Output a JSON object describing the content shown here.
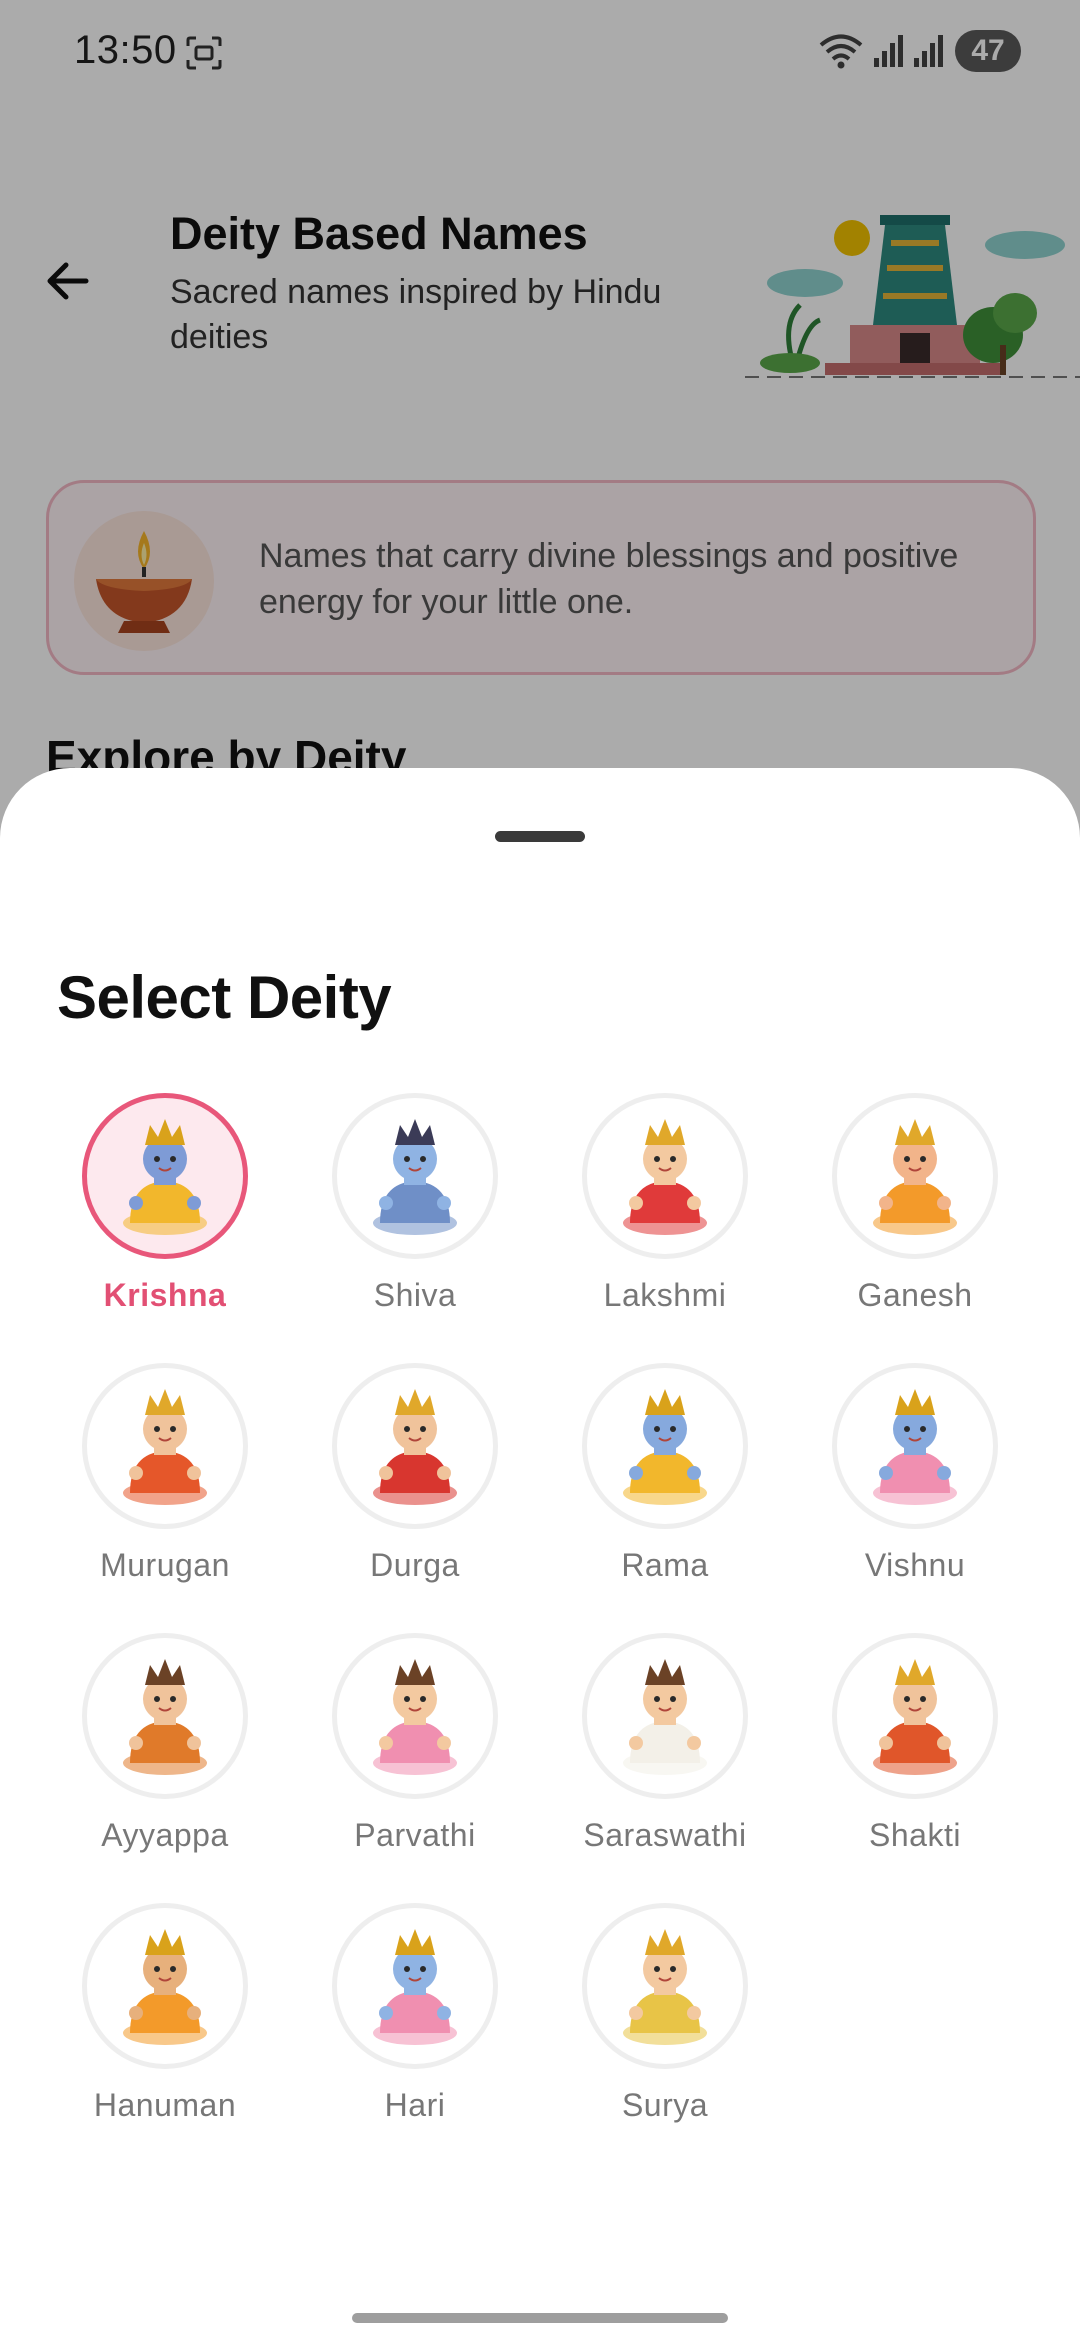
{
  "status_bar": {
    "time": "13:50",
    "battery": "47"
  },
  "header": {
    "title": "Deity Based Names",
    "subtitle": "Sacred names inspired by Hindu deities"
  },
  "info_card": {
    "text": "Names that carry divine blessings and positive energy for your little one."
  },
  "section": {
    "title": "Explore by Deity"
  },
  "sheet": {
    "title": "Select Deity",
    "selected": "Krishna",
    "deities": [
      {
        "label": "Krishna",
        "skin": "#7e9bd6",
        "robe": "#f2b72c",
        "crown": "#d9a21b"
      },
      {
        "label": "Shiva",
        "skin": "#8fb3e3",
        "robe": "#6f8fc7",
        "crown": "#3b3b57"
      },
      {
        "label": "Lakshmi",
        "skin": "#f3c9a0",
        "robe": "#e03a3a",
        "crown": "#e0a82a"
      },
      {
        "label": "Ganesh",
        "skin": "#f2b48a",
        "robe": "#f39a2a",
        "crown": "#e0a82a"
      },
      {
        "label": "Murugan",
        "skin": "#f0c39b",
        "robe": "#e5572a",
        "crown": "#e0a82a"
      },
      {
        "label": "Durga",
        "skin": "#f0c39b",
        "robe": "#d8362f",
        "crown": "#e0a82a"
      },
      {
        "label": "Rama",
        "skin": "#86a9dd",
        "robe": "#f2b72c",
        "crown": "#d9a21b"
      },
      {
        "label": "Vishnu",
        "skin": "#86a9dd",
        "robe": "#f08fb0",
        "crown": "#d9a21b"
      },
      {
        "label": "Ayyappa",
        "skin": "#f0c39b",
        "robe": "#e07a2a",
        "crown": "#6b4226"
      },
      {
        "label": "Parvathi",
        "skin": "#f3c9a0",
        "robe": "#f08fb0",
        "crown": "#6b4226"
      },
      {
        "label": "Saraswathi",
        "skin": "#f3c9a0",
        "robe": "#f3f0e8",
        "crown": "#6b4226"
      },
      {
        "label": "Shakti",
        "skin": "#f0c39b",
        "robe": "#e0562a",
        "crown": "#e0a82a"
      },
      {
        "label": "Hanuman",
        "skin": "#e7b07c",
        "robe": "#f39a2a",
        "crown": "#d9a21b"
      },
      {
        "label": "Hari",
        "skin": "#8fb3e3",
        "robe": "#f08fb0",
        "crown": "#d9a21b"
      },
      {
        "label": "Surya",
        "skin": "#f3c9a0",
        "robe": "#e8c447",
        "crown": "#e0a82a"
      }
    ]
  }
}
